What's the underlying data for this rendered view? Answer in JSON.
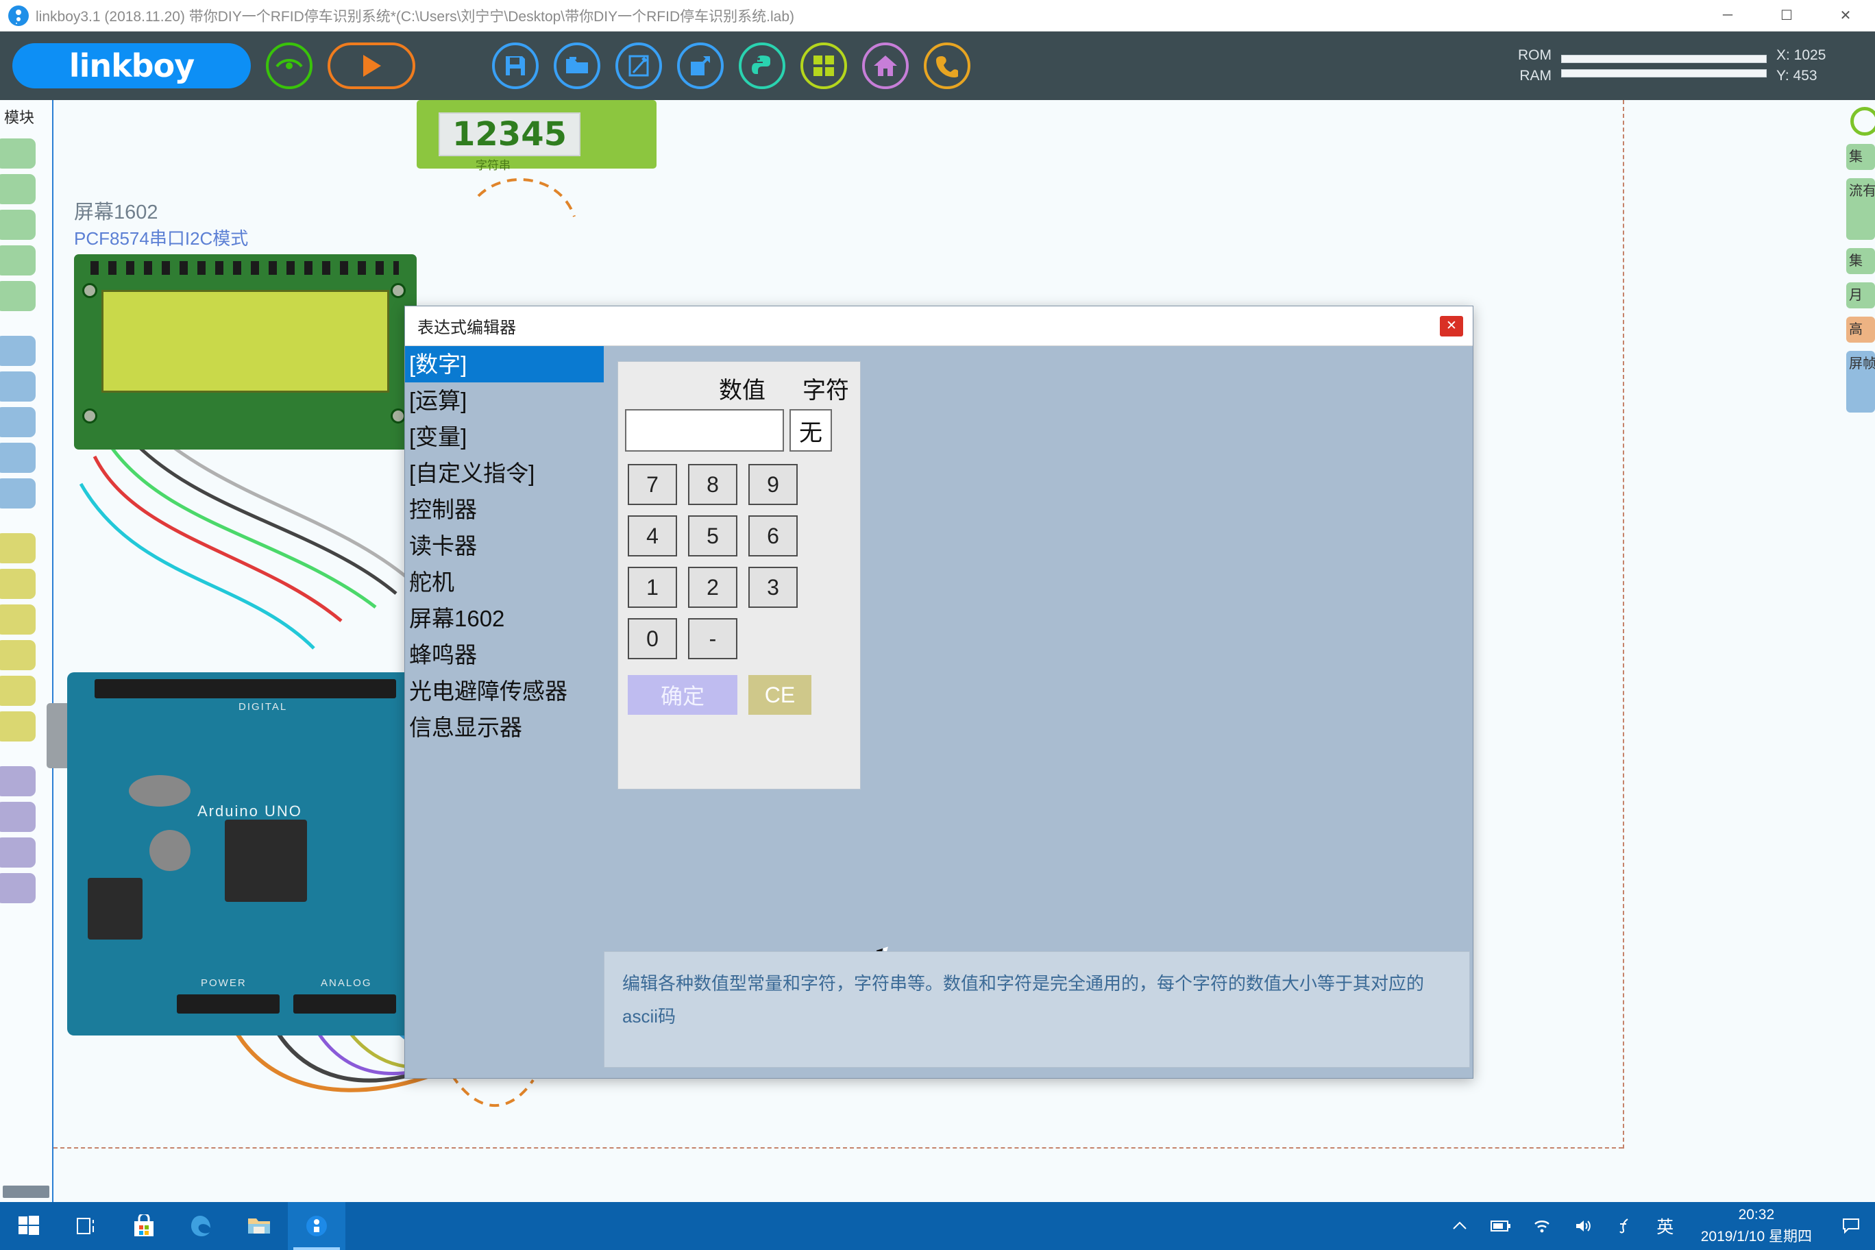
{
  "window": {
    "title": "linkboy3.1 (2018.11.20) 带你DIY一个RFID停车识别系统*(C:\\Users\\刘宁宁\\Desktop\\带你DIY一个RFID停车识别系统.lab)",
    "minimize_label": "─",
    "maximize_label": "☐",
    "close_label": "✕"
  },
  "toolbar": {
    "logo_text": "linkboy",
    "icons": [
      {
        "name": "preview-eye-icon",
        "color": "#39c30a"
      },
      {
        "name": "run-play-icon",
        "color": "#f07c1e"
      },
      {
        "name": "save-icon",
        "color": "#39a0f5"
      },
      {
        "name": "open-folder-icon",
        "color": "#39a0f5"
      },
      {
        "name": "edit-note-icon",
        "color": "#39a0f5"
      },
      {
        "name": "export-icon",
        "color": "#39a0f5"
      },
      {
        "name": "python-icon",
        "color": "#2ad3b0"
      },
      {
        "name": "grid-modules-icon",
        "color": "#b5d61d"
      },
      {
        "name": "home-icon",
        "color": "#c77ed8"
      },
      {
        "name": "phone-icon",
        "color": "#e8a522"
      }
    ],
    "meters": {
      "rom_label": "ROM",
      "ram_label": "RAM",
      "rom_percent": 0,
      "ram_percent": 0
    },
    "coords": {
      "x_label": "X: 1025",
      "y_label": "Y: 453"
    }
  },
  "sidebar": {
    "title": "模块",
    "groups": [
      {
        "color": "#9ed3a0",
        "count": 5
      },
      {
        "color": "#92bcdf",
        "count": 5
      },
      {
        "color": "#dad771",
        "count": 6
      },
      {
        "color": "#b0aad6",
        "count": 4
      }
    ]
  },
  "right_panel": {
    "blocks": [
      {
        "text": "集",
        "color": "#9ed3a0"
      },
      {
        "text": "流有",
        "color": "#9ed3a0"
      },
      {
        "text": "集",
        "color": "#9ed3a0"
      },
      {
        "text": "月",
        "color": "#9ed3a0"
      },
      {
        "text": "高",
        "color": "#edb383"
      },
      {
        "text": "屏帧",
        "color": "#92bcdf"
      }
    ]
  },
  "canvas": {
    "number_node_value": "12345",
    "number_node_label": "字符串",
    "lcd_title": "屏幕1602",
    "lcd_subtitle": "PCF8574串口I2C模式",
    "board_label": "Arduino UNO",
    "board_digital": "DIGITAL",
    "board_power": "POWER",
    "board_analog": "ANALOG"
  },
  "dialog": {
    "title": "表达式编辑器",
    "close_label": "✕",
    "list": [
      {
        "label": "[数字]",
        "selected": true
      },
      {
        "label": "[运算]",
        "selected": false
      },
      {
        "label": "[变量]",
        "selected": false
      },
      {
        "label": "[自定义指令]",
        "selected": false
      },
      {
        "label": "控制器",
        "selected": false
      },
      {
        "label": "读卡器",
        "selected": false
      },
      {
        "label": "舵机",
        "selected": false
      },
      {
        "label": "屏幕1602",
        "selected": false
      },
      {
        "label": "蜂鸣器",
        "selected": false
      },
      {
        "label": "光电避障传感器",
        "selected": false
      },
      {
        "label": "信息显示器",
        "selected": false
      }
    ],
    "keypad": {
      "value_header": "数值",
      "char_header": "字符",
      "value_input": "",
      "value_placeholder": "",
      "char_value": "无",
      "keys": [
        [
          "7",
          "8",
          "9"
        ],
        [
          "4",
          "5",
          "6"
        ],
        [
          "1",
          "2",
          "3"
        ],
        [
          "0",
          "-"
        ]
      ],
      "ok_label": "确定",
      "ce_label": "CE"
    },
    "description": "编辑各种数值型常量和字符，字符串等。数值和字符是完全通用的，每个字符的数值大小等于其对应的ascii码"
  },
  "taskbar": {
    "items": [
      {
        "name": "start-button"
      },
      {
        "name": "task-view-button"
      },
      {
        "name": "microsoft-store-button"
      },
      {
        "name": "edge-browser-button"
      },
      {
        "name": "file-explorer-button"
      },
      {
        "name": "linkboy-app-button"
      }
    ],
    "tray": [
      {
        "name": "show-hidden-icons",
        "glyph": "∧"
      },
      {
        "name": "battery-icon",
        "glyph": "▭"
      },
      {
        "name": "wifi-icon",
        "glyph": "◠"
      },
      {
        "name": "volume-icon",
        "glyph": "ὐA"
      },
      {
        "name": "pen-icon",
        "glyph": "✎"
      },
      {
        "name": "ime-icon",
        "glyph": "英"
      }
    ],
    "clock_time": "20:32",
    "clock_date": "2019/1/10 星期四"
  },
  "colors": {
    "toolbar_bg": "#3c4c52",
    "accent_blue": "#0d8ff5",
    "dialog_bg": "#a9bcd0",
    "selected_blue": "#0a7ad1",
    "taskbar_blue": "#0b61ab"
  }
}
